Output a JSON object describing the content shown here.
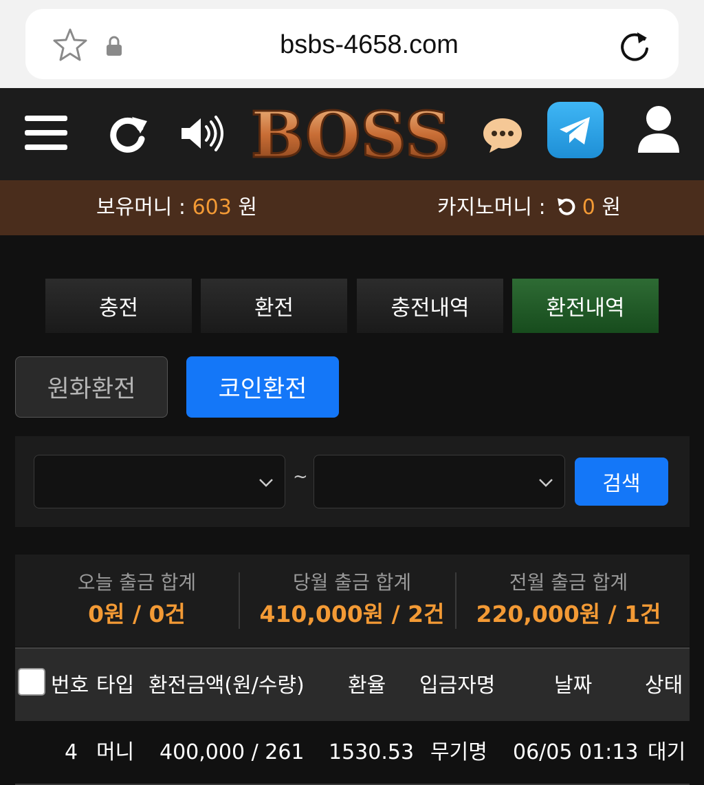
{
  "browser": {
    "url": "bsbs-4658.com"
  },
  "header": {
    "logo_text": "BOSS"
  },
  "money": {
    "holding_label": "보유머니 : ",
    "holding_value": "603",
    "holding_unit": " 원",
    "casino_label": "카지노머니 : ",
    "casino_value": "0",
    "casino_unit": " 원"
  },
  "tabs": [
    {
      "label": "충전"
    },
    {
      "label": "환전"
    },
    {
      "label": "충전내역"
    },
    {
      "label": "환전내역"
    }
  ],
  "subtabs": {
    "won": "원화환전",
    "coin": "코인환전"
  },
  "search": {
    "tilde": "~",
    "button": "검색",
    "from_value": "",
    "to_value": ""
  },
  "summary": [
    {
      "label": "오늘 출금 합계",
      "value": "0원 / 0건"
    },
    {
      "label": "당월 출금 합계",
      "value": "410,000원 / 2건"
    },
    {
      "label": "전월 출금 합계",
      "value": "220,000원 / 1건"
    }
  ],
  "table": {
    "headers": [
      "번호",
      "타입",
      "환전금액(원/수량)",
      "환율",
      "입금자명",
      "날짜",
      "상태"
    ],
    "rows": [
      {
        "no": "4",
        "type": "머니",
        "amount": "400,000 / 261",
        "rate": "1530.53",
        "depositor": "무기명",
        "date": "06/05 01:13",
        "status": "대기"
      }
    ]
  },
  "colors": {
    "accent_blue": "#1477f8",
    "accent_orange": "#f39a35",
    "active_tab_green": "#2e6b34",
    "money_bar": "#4a2d1c"
  },
  "icons": [
    "star-icon",
    "lock-icon",
    "reload-icon",
    "menu-icon",
    "refresh-icon",
    "speaker-icon",
    "chat-icon",
    "telegram-icon",
    "user-icon",
    "undo-icon",
    "chevron-down-icon"
  ]
}
